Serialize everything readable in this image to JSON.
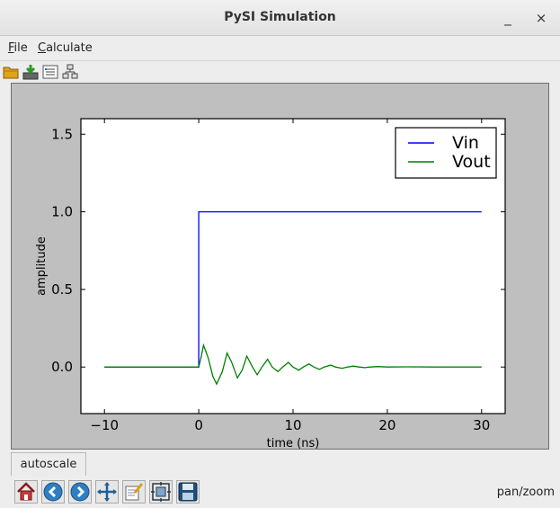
{
  "window": {
    "title": "PySI Simulation",
    "minimize_glyph": "_",
    "close_glyph": "×"
  },
  "menu": [
    "File",
    "Calculate"
  ],
  "toolbar": {
    "icons": [
      "open-folder-icon",
      "download-icon",
      "list-icon",
      "network-icon"
    ]
  },
  "chart_data": {
    "type": "line",
    "xlabel": "time (ns)",
    "ylabel": "amplitude",
    "xlim": [
      -12.5,
      32.5
    ],
    "ylim": [
      -0.3,
      1.6
    ],
    "xticks": [
      -10,
      0,
      10,
      20,
      30
    ],
    "xtick_labels": [
      "−10",
      "0",
      "10",
      "20",
      "30"
    ],
    "yticks": [
      0.0,
      0.5,
      1.0,
      1.5
    ],
    "ytick_labels": [
      "0.0",
      "0.5",
      "1.0",
      "1.5"
    ],
    "grid": false,
    "legend": "upper-right",
    "series": [
      {
        "name": "Vin",
        "color": "#0000ff",
        "x": [
          -10,
          0,
          0,
          30
        ],
        "y": [
          0,
          0,
          1,
          1
        ]
      },
      {
        "name": "Vout",
        "color": "#008000",
        "x": [
          -10,
          0,
          0.2,
          0.5,
          1.0,
          1.5,
          1.9,
          2.5,
          3.0,
          3.5,
          4.1,
          4.6,
          5.1,
          5.7,
          6.2,
          6.7,
          7.3,
          7.8,
          8.4,
          8.9,
          9.5,
          10.0,
          10.6,
          11.1,
          11.7,
          12.2,
          12.8,
          13.3,
          14.0,
          14.5,
          15.2,
          15.8,
          16.4,
          17.0,
          17.6,
          18.2,
          19.0,
          20.0,
          22.0,
          25.0,
          30.0
        ],
        "y": [
          0,
          0,
          0.05,
          0.14,
          0.06,
          -0.06,
          -0.11,
          -0.03,
          0.09,
          0.03,
          -0.07,
          -0.02,
          0.07,
          0.0,
          -0.05,
          0.0,
          0.05,
          0.0,
          -0.03,
          0.0,
          0.03,
          0.0,
          -0.02,
          0.0,
          0.02,
          0.0,
          -0.015,
          0.0,
          0.012,
          0.0,
          -0.008,
          0.0,
          0.006,
          0.0,
          -0.004,
          0.0,
          0.003,
          0.0,
          0.001,
          0.0,
          0.0
        ]
      }
    ]
  },
  "bottom": {
    "autoscale_label": "autoscale",
    "nav_icons": [
      "home-icon",
      "back-arrow-icon",
      "forward-arrow-icon",
      "pan-move-icon",
      "edit-axes-icon",
      "configure-subplots-icon",
      "save-disk-icon"
    ],
    "mode": "pan/zoom"
  }
}
